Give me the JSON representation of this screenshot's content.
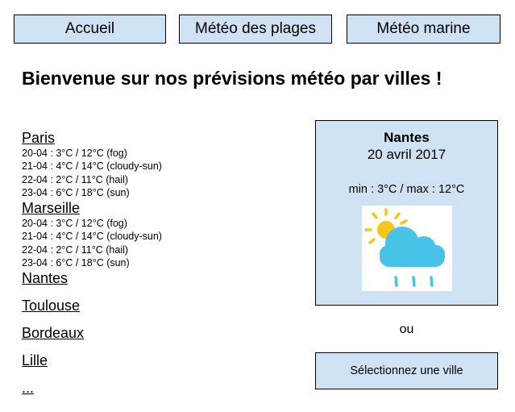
{
  "nav": {
    "home_label": "Accueil",
    "beaches_label": "Météo des plages",
    "marine_label": "Météo marine"
  },
  "page_title": "Bienvenue sur nos prévisions météo par villes !",
  "cities": [
    {
      "name": "Paris",
      "forecast": [
        "20-04 : 3°C / 12°C (fog)",
        "21-04 : 4°C / 14°C (cloudy-sun)",
        "22-04 : 2°C / 11°C (hail)",
        "23-04 : 6°C / 18°C (sun)"
      ]
    },
    {
      "name": "Marseille",
      "forecast": [
        "20-04 : 3°C / 12°C (fog)",
        "21-04 : 4°C / 14°C (cloudy-sun)",
        "22-04 : 2°C / 11°C (hail)",
        "23-04 : 6°C / 18°C (sun)"
      ]
    },
    {
      "name": "Nantes"
    },
    {
      "name": "Toulouse"
    },
    {
      "name": "Bordeaux"
    },
    {
      "name": "Lille"
    },
    {
      "name": "..."
    }
  ],
  "weather_card": {
    "city": "Nantes",
    "date": "20 avril 2017",
    "temperature": "min : 3°C / max : 12°C",
    "icon": "cloudy-sun-rain-icon"
  },
  "or_text": "ou",
  "select_city_label": "Sélectionnez une ville",
  "colors": {
    "panel_background": "#cfe2f3",
    "cloud": "#46c3e6",
    "sun": "#f5c518"
  }
}
